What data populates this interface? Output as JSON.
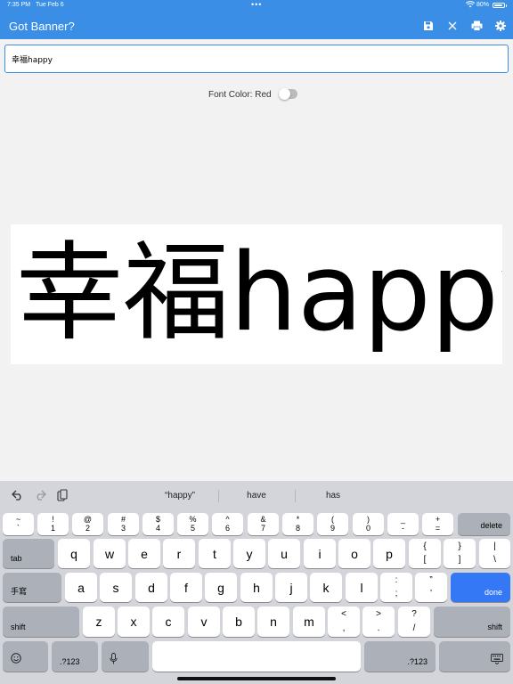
{
  "status_bar": {
    "time": "7:35 PM",
    "date": "Tue Feb 6",
    "battery": "80%"
  },
  "app_bar": {
    "title": "Got Banner?"
  },
  "input": {
    "value": "幸福happy"
  },
  "font_color": {
    "label": "Font Color: Red",
    "enabled": false
  },
  "banner": {
    "text": "幸福happy"
  },
  "keyboard": {
    "suggestions": [
      "“happy”",
      "have",
      "has"
    ],
    "number_row": [
      {
        "top": "~",
        "bottom": "`"
      },
      {
        "top": "!",
        "bottom": "1"
      },
      {
        "top": "@",
        "bottom": "2"
      },
      {
        "top": "#",
        "bottom": "3"
      },
      {
        "top": "$",
        "bottom": "4"
      },
      {
        "top": "%",
        "bottom": "5"
      },
      {
        "top": "^",
        "bottom": "6"
      },
      {
        "top": "&",
        "bottom": "7"
      },
      {
        "top": "*",
        "bottom": "8"
      },
      {
        "top": "(",
        "bottom": "9"
      },
      {
        "top": ")",
        "bottom": "0"
      },
      {
        "top": "_",
        "bottom": "-"
      },
      {
        "top": "+",
        "bottom": "="
      }
    ],
    "delete": "delete",
    "tab": "tab",
    "row_q": [
      "q",
      "w",
      "e",
      "r",
      "t",
      "y",
      "u",
      "i",
      "o",
      "p"
    ],
    "row_q_punct": [
      {
        "top": "{",
        "bottom": "["
      },
      {
        "top": "}",
        "bottom": "]"
      },
      {
        "top": "|",
        "bottom": "\\"
      }
    ],
    "handwriting": "手寫",
    "row_a": [
      "a",
      "s",
      "d",
      "f",
      "g",
      "h",
      "j",
      "k",
      "l"
    ],
    "row_a_punct": [
      {
        "top": ":",
        "bottom": ";"
      },
      {
        "top": "”",
        "bottom": "’"
      }
    ],
    "done": "done",
    "shift": "shift",
    "row_z": [
      "z",
      "x",
      "c",
      "v",
      "b",
      "n",
      "m"
    ],
    "row_z_punct": [
      {
        "top": "<",
        "bottom": ","
      },
      {
        "top": ">",
        "bottom": "."
      },
      {
        "top": "?",
        "bottom": "/"
      }
    ],
    "numbers_key": ".?123"
  }
}
